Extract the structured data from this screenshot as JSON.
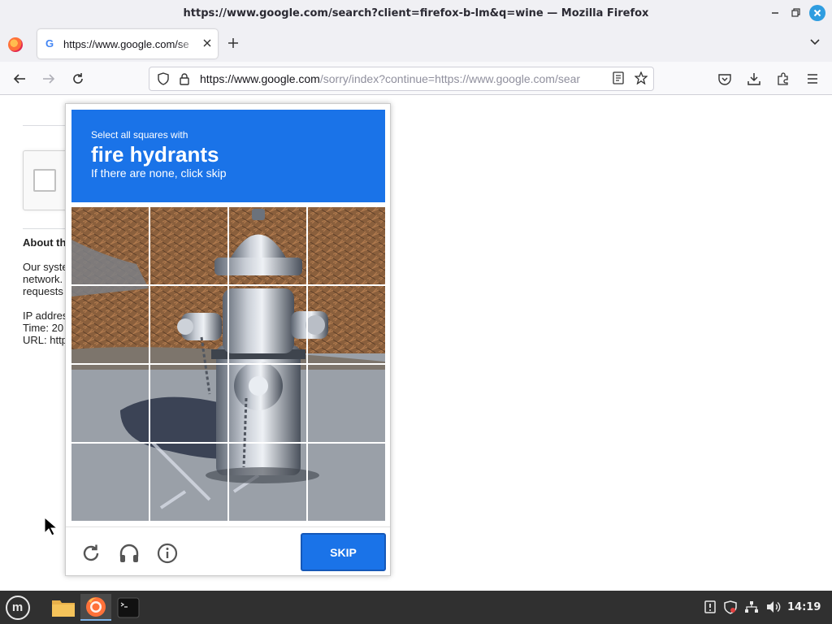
{
  "window": {
    "title": "https://www.google.com/search?client=firefox-b-lm&q=wine — Mozilla Firefox"
  },
  "tabs": [
    {
      "label": "https://www.google.com/se",
      "favicon": "google-g-icon"
    }
  ],
  "navbar": {
    "url_host": "https://www.google.com",
    "url_path": "/sorry/index?continue=https://www.google.com/sear"
  },
  "page": {
    "about_heading": "About th",
    "body_lines": [
      "Our syste",
      "network.",
      "requests"
    ],
    "ip_line": "IP addres",
    "time_line": "Time: 20",
    "url_line": "URL: http"
  },
  "captcha": {
    "instruction_small": "Select all squares with",
    "target_object": "fire hydrants",
    "instruction_sub": "If there are none, click skip",
    "skip_label": "SKIP",
    "header_color": "#1a73e8",
    "grid_rows": 4,
    "grid_cols": 4
  },
  "taskbar": {
    "clock": "14:19",
    "apps": [
      "linux-mint-menu-icon",
      "files-folder-icon",
      "firefox-icon",
      "terminal-icon"
    ]
  }
}
